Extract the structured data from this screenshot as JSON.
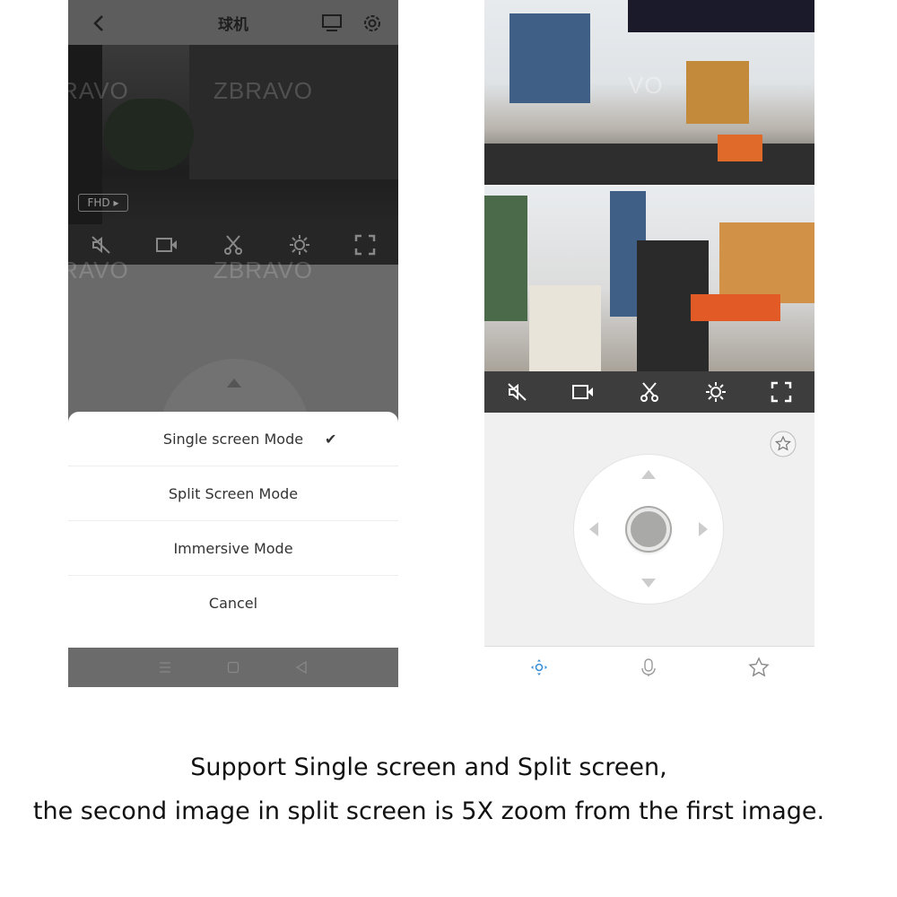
{
  "watermark": "ZBRAVO",
  "left_phone": {
    "header": {
      "title": "球机",
      "back_icon": "chevron-left-icon",
      "screen_icon": "monitor-icon",
      "settings_icon": "gear-icon"
    },
    "video": {
      "quality_label": "FHD"
    },
    "controls": [
      "mute-icon",
      "record-icon",
      "scissors-icon",
      "brightness-icon",
      "fullscreen-icon"
    ],
    "mode_sheet": {
      "options": [
        {
          "label": "Single screen Mode",
          "selected": true
        },
        {
          "label": "Split Screen Mode",
          "selected": false
        },
        {
          "label": "Immersive Mode",
          "selected": false
        }
      ],
      "cancel": "Cancel"
    },
    "nav": [
      "menu-icon",
      "home-icon",
      "back-icon"
    ]
  },
  "right_phone": {
    "controls": [
      "mute-icon",
      "record-icon",
      "scissors-icon",
      "brightness-icon",
      "fullscreen-icon"
    ],
    "tabs": [
      {
        "icon": "ptz-icon",
        "active": true
      },
      {
        "icon": "microphone-icon",
        "active": false
      },
      {
        "icon": "star-icon",
        "active": false
      }
    ],
    "accent": "#3a8fd6"
  },
  "caption": {
    "line1": "Support Single screen and Split screen,",
    "line2": "the second image in split screen is 5X zoom from the first image."
  }
}
